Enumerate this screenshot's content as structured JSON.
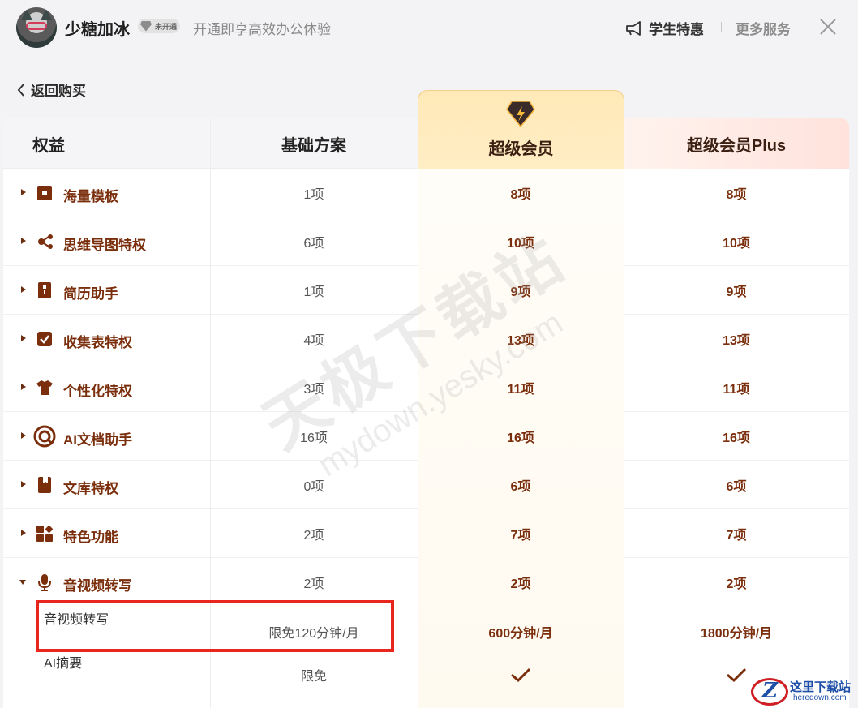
{
  "header": {
    "username": "少糖加冰",
    "vip_status": "未开通",
    "tagline": "开通即享高效办公体验",
    "student_offer": "学生特惠",
    "more_services": "更多服务"
  },
  "back_label": "返回购买",
  "table": {
    "headers": {
      "benefit": "权益",
      "basic": "基础方案",
      "super": "超级会员",
      "plus": "超级会员Plus"
    },
    "rows": [
      {
        "icon": "template-icon",
        "name": "海量模板",
        "basic": "1项",
        "super": "8项",
        "plus": "8项"
      },
      {
        "icon": "mindmap-icon",
        "name": "思维导图特权",
        "basic": "6项",
        "super": "10项",
        "plus": "10项"
      },
      {
        "icon": "resume-icon",
        "name": "简历助手",
        "basic": "1项",
        "super": "9项",
        "plus": "9项"
      },
      {
        "icon": "form-check-icon",
        "name": "收集表特权",
        "basic": "4项",
        "super": "13项",
        "plus": "13项"
      },
      {
        "icon": "tshirt-icon",
        "name": "个性化特权",
        "basic": "3项",
        "super": "11项",
        "plus": "11项"
      },
      {
        "icon": "ai-doc-icon",
        "name": "AI文档助手",
        "basic": "16项",
        "super": "16项",
        "plus": "16项"
      },
      {
        "icon": "library-icon",
        "name": "文库特权",
        "basic": "0项",
        "super": "6项",
        "plus": "6项"
      },
      {
        "icon": "features-icon",
        "name": "特色功能",
        "basic": "2项",
        "super": "7项",
        "plus": "7项"
      },
      {
        "icon": "microphone-icon",
        "name": "音视频转写",
        "basic": "2项",
        "super": "2项",
        "plus": "2项"
      }
    ],
    "subrows": [
      {
        "name": "音视频转写",
        "basic": "限免120分钟/月",
        "super": "600分钟/月",
        "plus": "1800分钟/月"
      },
      {
        "name": "AI摘要",
        "basic": "限免",
        "super": "check",
        "plus": "check"
      }
    ]
  },
  "watermark": {
    "line1": "天极下载站",
    "line2": "mydown.yesky.com"
  },
  "site_logo": {
    "name": "这里下载站",
    "url_text": "heredown.com"
  },
  "colors": {
    "accent_text": "#7a2e0c",
    "super_col": "#ffe9b8",
    "highlight_box": "#e8261e"
  }
}
